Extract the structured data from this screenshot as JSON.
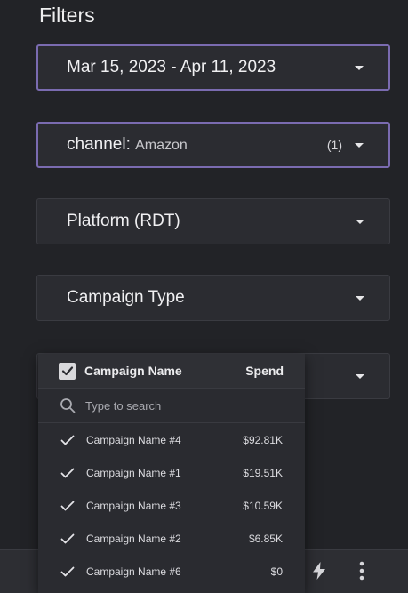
{
  "title": "Filters",
  "filters": [
    {
      "label": "Mar 15, 2023 - Apr 11, 2023",
      "value": "",
      "count": "",
      "active": true
    },
    {
      "label": "channel",
      "value": "Amazon",
      "count": "(1)",
      "active": true
    },
    {
      "label": "Platform (RDT)",
      "value": "",
      "count": "",
      "active": false
    },
    {
      "label": "Campaign Type",
      "value": "",
      "count": "",
      "active": false
    }
  ],
  "campaign_dropdown": {
    "header": {
      "name_label": "Campaign Name",
      "spend_label": "Spend"
    },
    "search": {
      "placeholder": "Type to search"
    },
    "items": [
      {
        "name": "Campaign Name #4",
        "spend": "$92.81K",
        "checked": true
      },
      {
        "name": "Campaign Name #1",
        "spend": "$19.51K",
        "checked": true
      },
      {
        "name": "Campaign Name #3",
        "spend": "$10.59K",
        "checked": true
      },
      {
        "name": "Campaign Name #2",
        "spend": "$6.85K",
        "checked": true
      },
      {
        "name": "Campaign Name #6",
        "spend": "$0",
        "checked": true
      }
    ]
  },
  "toolbar": {
    "icons": [
      "bolt-icon",
      "more-vert-icon"
    ]
  },
  "colors": {
    "background": "#222327",
    "card": "#2b2c31",
    "active_border": "#7a6bb0"
  }
}
